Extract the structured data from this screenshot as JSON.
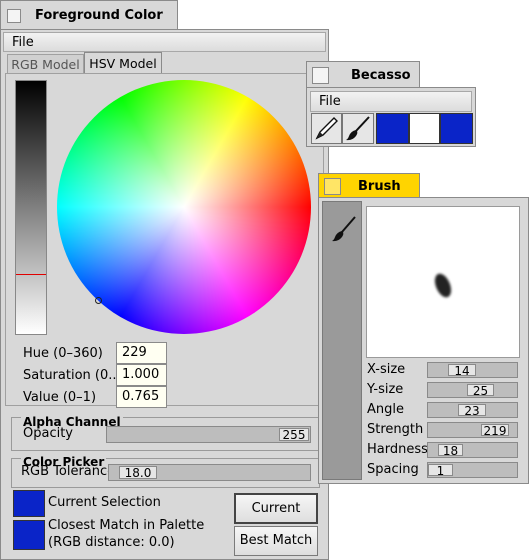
{
  "foreground_window": {
    "title": "Foreground Color",
    "menu": [
      "File"
    ],
    "tabs": [
      {
        "label": "RGB Model",
        "active": false
      },
      {
        "label": "HSV Model",
        "active": true
      }
    ],
    "fields": [
      {
        "label": "Hue (0–360)",
        "value": "229"
      },
      {
        "label": "Saturation (0...",
        "value": "1.000"
      },
      {
        "label": "Value (0–1)",
        "value": "0.765"
      }
    ],
    "alpha_channel": {
      "title": "Alpha Channel",
      "label": "Opacity",
      "value": "255",
      "level": 1.0
    },
    "color_picker": {
      "title": "Color Picker",
      "label": "RGB Tolerance",
      "value": "18.0"
    },
    "current_selection_label": "Current Selection",
    "closest_match_label": "Closest Match in Palette",
    "closest_match_distance": "(RGB distance: 0.0)",
    "current_button": "Current",
    "best_match_button": "Best Match",
    "swatch_color": "#0a24c8"
  },
  "becasso_window": {
    "title": "Becasso",
    "menu": [
      "File"
    ],
    "tools": [
      "pencil-icon",
      "brush-icon"
    ],
    "foreground_color": "#0a24c8",
    "background_color": "#ffffff"
  },
  "brush_window": {
    "title": "Brush",
    "title_color": "#ffd400",
    "params": [
      {
        "label": "X-size",
        "value": "14",
        "level": 0.14
      },
      {
        "label": "Y-size",
        "value": "25",
        "level": 0.25
      },
      {
        "label": "Angle",
        "value": "23",
        "level": 0.23
      },
      {
        "label": "Strength",
        "value": "219",
        "level": 0.86
      },
      {
        "label": "Hardness",
        "value": "18",
        "level": 0.18
      },
      {
        "label": "Spacing",
        "value": "1",
        "level": 0.01
      }
    ]
  }
}
